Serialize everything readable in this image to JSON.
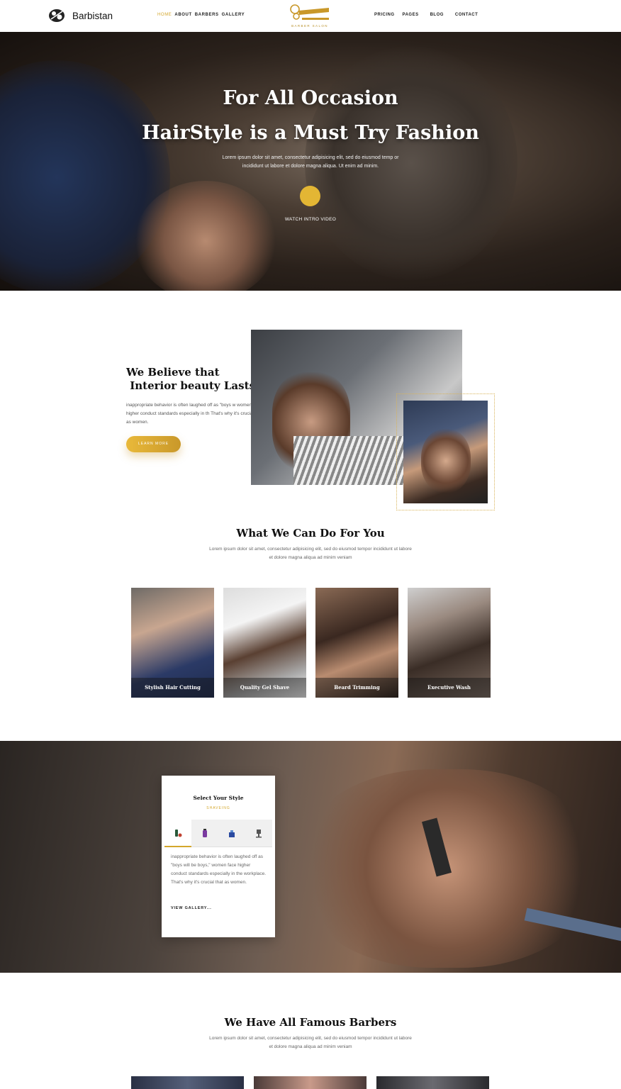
{
  "brand": {
    "name": "Barbistan"
  },
  "nav": {
    "left": [
      "HOME",
      "ABOUT",
      "BARBERS",
      "GALLERY"
    ],
    "right": [
      "PRICING",
      "PAGES",
      "BLOG",
      "CONTACT"
    ],
    "center_logo_text": "BARBER SALON"
  },
  "hero": {
    "title_line1": "For All Occasion",
    "title_line2": "HairStyle is a Must Try Fashion",
    "subtitle_line1": "Lorem ipsum dolor sit amet, consectetur adipisicing elit, sed do eiusmod temp or",
    "subtitle_line2": "incididunt ut labore et dolore magna aliqua. Ut enim ad minim.",
    "watch_label": "WATCH INTRO VIDEO"
  },
  "about": {
    "title": "We Believe that\n Interior beauty Lasts Lo",
    "text": "inappropriate behavior is often laughed off as \"boys w women face higher conduct standards especially in th That's why it's crucial that as women.",
    "button_label": "LEARN MORE"
  },
  "services": {
    "title": "What We Can Do For You",
    "subtitle_line1": "Lorem ipsum dolor sit amet, consectetur adipisicing elit, sed do eiusmod tempor incididunt ut labore",
    "subtitle_line2": "et dolore magna aliqua ad minim veniam",
    "items": [
      {
        "label": "Stylish Hair Cutting"
      },
      {
        "label": "Quality Gel Shave"
      },
      {
        "label": "Beard Trimming"
      },
      {
        "label": "Executive Wash"
      }
    ]
  },
  "style_card": {
    "title": "Select Your Style",
    "subtitle": "SHAVEING",
    "tabs": [
      "clipper-icon",
      "gel-bottle-icon",
      "spray-icon",
      "barber-chair-icon"
    ],
    "text": "inappropriate behavior is often laughed off as \"boys will be boys,\" women face higher conduct standards especially in the workplace. That's why it's crucial that as women.",
    "link_label": "VIEW GALLERY..."
  },
  "barbers": {
    "title": "We Have All Famous Barbers",
    "subtitle_line1": "Lorem ipsum dolor sit amet, consectetur adipisicing elit, sed do eiusmod tempor incididunt ut labore",
    "subtitle_line2": "et dolore magna aliqua ad minim veniam"
  },
  "colors": {
    "accent": "#d4a72c",
    "button_gold": "#e9b93a"
  }
}
